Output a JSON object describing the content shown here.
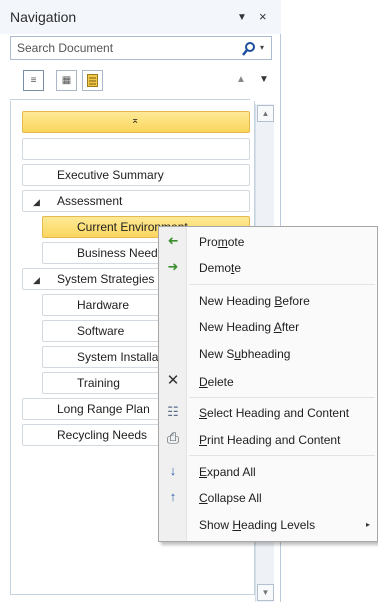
{
  "pane": {
    "title": "Navigation",
    "menu_icon": "▼",
    "close_icon": "×"
  },
  "search": {
    "placeholder": "Search Document",
    "icon": "⚲",
    "dropdown_icon": "▾"
  },
  "tabs": {
    "tab1_icon": "≡",
    "tab2_icon": "▦",
    "tab3_icon": "▤",
    "prev_icon": "▲",
    "next_icon": "▼"
  },
  "scroll": {
    "up": "▲",
    "down": "▼"
  },
  "headings": [
    {
      "label": "",
      "icon": "⌅"
    },
    {
      "label": ""
    },
    {
      "label": "Executive Summary"
    },
    {
      "label": "Assessment",
      "icon": "◢"
    },
    {
      "label": "Current Environment"
    },
    {
      "label": "Business Needs"
    },
    {
      "label": "System Strategies",
      "icon": "◢"
    },
    {
      "label": "Hardware"
    },
    {
      "label": "Software"
    },
    {
      "label": "System Installation"
    },
    {
      "label": "Training"
    },
    {
      "label": "Long Range Plan"
    },
    {
      "label": "Recycling Needs"
    }
  ],
  "context_menu": {
    "items": [
      {
        "pre": "Pro",
        "u": "m",
        "post": "ote",
        "icon": "➜",
        "icon_color": "#3c8d2f"
      },
      {
        "pre": "Demo",
        "u": "t",
        "post": "e",
        "icon": "➜",
        "icon_color": "#3c8d2f"
      },
      {
        "pre": "New Heading ",
        "u": "B",
        "post": "efore"
      },
      {
        "pre": "New Heading ",
        "u": "A",
        "post": "fter"
      },
      {
        "pre": "New S",
        "u": "u",
        "post": "bheading"
      },
      {
        "pre": "",
        "u": "D",
        "post": "elete",
        "icon": "✕",
        "icon_color": "#333333"
      },
      {
        "pre": "",
        "u": "S",
        "post": "elect Heading and Content",
        "icon": "☷",
        "icon_color": "#5a6e8c"
      },
      {
        "pre": "",
        "u": "P",
        "post": "rint Heading and Content",
        "icon": "⎙",
        "icon_color": "#4a5a6a"
      },
      {
        "pre": "",
        "u": "E",
        "post": "xpand All",
        "icon": "↓",
        "icon_color": "#2a5fa8"
      },
      {
        "pre": "",
        "u": "C",
        "post": "ollapse All",
        "icon": "↑",
        "icon_color": "#2a5fa8"
      },
      {
        "pre": "Show ",
        "u": "H",
        "post": "eading Levels"
      }
    ],
    "submenu_arrow": "▸"
  }
}
